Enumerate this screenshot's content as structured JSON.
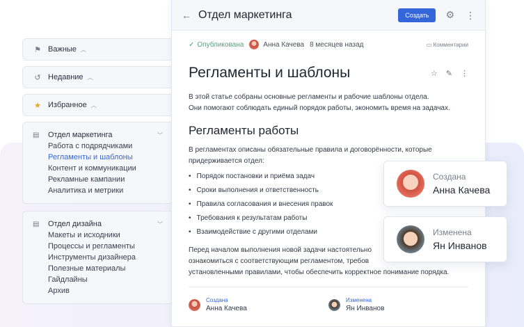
{
  "sidebar": {
    "important": {
      "label": "Важные",
      "icon": "flag-icon"
    },
    "recent": {
      "label": "Недавние",
      "icon": "history-icon"
    },
    "favorites": {
      "label": "Избранное",
      "icon": "star-icon"
    },
    "groups": [
      {
        "title": "Отдел маркетинга",
        "items": [
          "Работа с подрядчиками",
          "Регламенты и шаблоны",
          "Контент и коммуникации",
          "Рекламные кампании",
          "Аналитика и метрики"
        ]
      },
      {
        "title": "Отдел дизайна",
        "items": [
          "Макеты и исходники",
          "Процессы и регламенты",
          "Инструменты дизайнера",
          "Полезные материалы",
          "Гайдлайны",
          "Архив"
        ]
      }
    ]
  },
  "header": {
    "title": "Отдел маркетинга",
    "create_label": "Создать"
  },
  "meta": {
    "status": "Опубликована",
    "author": "Анна Качева",
    "time": "8 месяцев назад",
    "comments": "Комментарии"
  },
  "article": {
    "title": "Регламенты и шаблоны",
    "intro_1": "В этой статье собраны основные регламенты и рабочие шаблоны отдела.",
    "intro_2": "Они помогают соблюдать единый порядок работы, экономить время на задачах.",
    "section_title": "Регламенты работы",
    "section_1": "В регламентах описаны обязательные правила и договорённости, которые",
    "section_2": "придерживается отдел:",
    "bullets": [
      "Порядок постановки и приёма задач",
      "Сроки выполнения и ответственность",
      "Правила согласования и внесения правок",
      "Требования к результатам работы",
      "Взаимодействие с другими отделами"
    ],
    "outro_1": "Перед началом выполнения новой задачи настоятельно",
    "outro_2": "ознакомиться с соответствующим регламентом, требов",
    "outro_3": "установленными правилами, чтобы обеспечить корректное понимание порядка."
  },
  "footer": {
    "created_label": "Создана",
    "created_name": "Анна Качева",
    "changed_label": "Изменена",
    "changed_name": "Ян Инванов"
  },
  "cards": {
    "created_label": "Создана",
    "created_name": "Анна Качева",
    "changed_label": "Изменена",
    "changed_name": "Ян Инванов"
  },
  "colors": {
    "accent": "#3466d9",
    "published": "#3fa86b"
  }
}
